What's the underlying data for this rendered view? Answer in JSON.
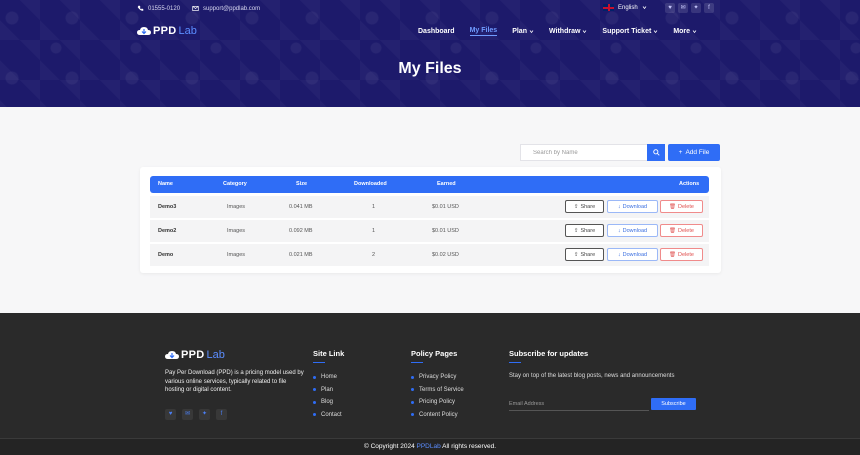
{
  "topbar": {
    "phone": "01555-0120",
    "email": "support@ppdlab.com",
    "language": "English",
    "social_icons": [
      "twitter-icon",
      "mail-icon",
      "bird-icon",
      "facebook-icon"
    ]
  },
  "brand": {
    "part_a": "PPD",
    "part_b": "Lab"
  },
  "nav": [
    {
      "label": "Dashboard",
      "has_dropdown": false,
      "active": false
    },
    {
      "label": "My Files",
      "has_dropdown": false,
      "active": true
    },
    {
      "label": "Plan",
      "has_dropdown": true,
      "active": false
    },
    {
      "label": "Withdraw",
      "has_dropdown": true,
      "active": false
    },
    {
      "label": "Support Ticket",
      "has_dropdown": true,
      "active": false
    },
    {
      "label": "More",
      "has_dropdown": true,
      "active": false
    }
  ],
  "page_title": "My Files",
  "search": {
    "placeholder": "Search by Name"
  },
  "add_button": "Add File",
  "table": {
    "headers": {
      "name": "Name",
      "category": "Category",
      "size": "Size",
      "downloaded": "Downloaded",
      "earned": "Earned",
      "actions": "Actions"
    },
    "rows": [
      {
        "name": "Demo3",
        "category": "Images",
        "size": "0.041 MB",
        "downloaded": "1",
        "earned": "$0.01 USD"
      },
      {
        "name": "Demo2",
        "category": "Images",
        "size": "0.092 MB",
        "downloaded": "1",
        "earned": "$0.01 USD"
      },
      {
        "name": "Demo",
        "category": "Images",
        "size": "0.021 MB",
        "downloaded": "2",
        "earned": "$0.02 USD"
      }
    ],
    "actions": {
      "share": "Share",
      "download": "Download",
      "delete": "Delete"
    }
  },
  "footer": {
    "description": "Pay Per Download (PPD) is a pricing model used by various online services, typically related to file hosting or digital content.",
    "site_link": {
      "title": "Site Link",
      "items": [
        "Home",
        "Plan",
        "Blog",
        "Contact"
      ]
    },
    "policy_pages": {
      "title": "Policy Pages",
      "items": [
        "Privacy Policy",
        "Terms of Service",
        "Pricing Policy",
        "Content Policy"
      ]
    },
    "subscribe": {
      "title": "Subscribe for updates",
      "text": "Stay on top of the latest blog posts, news and announcements",
      "placeholder": "Email Address",
      "button": "Subscribe"
    },
    "copyright_prefix": "© Copyright 2024",
    "copyright_brand": "PPDLab",
    "copyright_suffix": "All rights reserved."
  },
  "colors": {
    "primary": "#2f6df6",
    "hero": "#1d1a6b",
    "footer": "#2a2a2a",
    "danger": "#e0504f"
  }
}
